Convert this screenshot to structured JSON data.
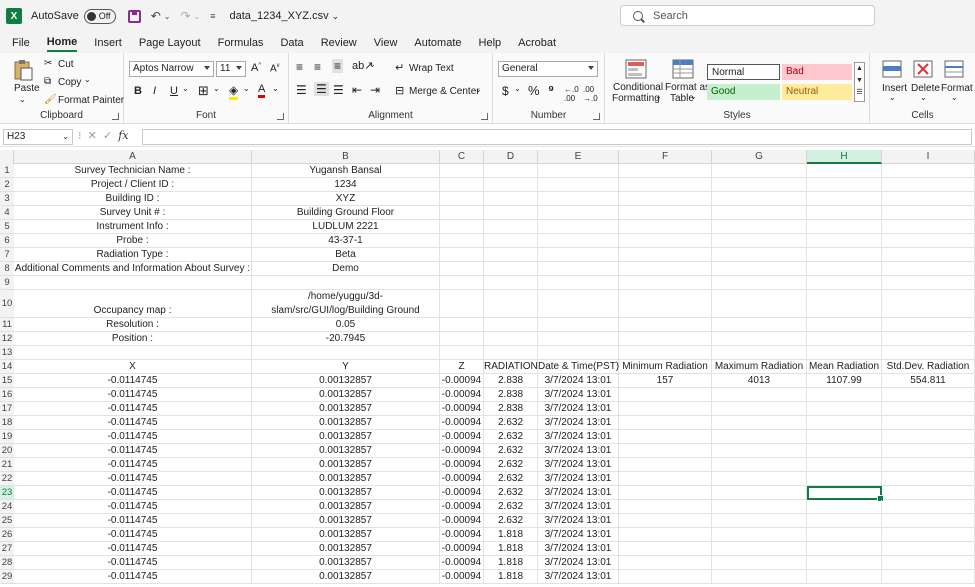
{
  "titlebar": {
    "autosave_label": "AutoSave",
    "autosave_state": "Off",
    "filename": "data_1234_XYZ.csv",
    "search_placeholder": "Search"
  },
  "menu": [
    "File",
    "Home",
    "Insert",
    "Page Layout",
    "Formulas",
    "Data",
    "Review",
    "View",
    "Automate",
    "Help",
    "Acrobat"
  ],
  "menu_active": "Home",
  "ribbon": {
    "clipboard": {
      "paste": "Paste",
      "cut": "Cut",
      "copy": "Copy",
      "format_painter": "Format Painter",
      "label": "Clipboard"
    },
    "font": {
      "name": "Aptos Narrow",
      "size": "11",
      "label": "Font"
    },
    "alignment": {
      "wrap": "Wrap Text",
      "merge": "Merge & Center",
      "label": "Alignment"
    },
    "number": {
      "format": "General",
      "label": "Number"
    },
    "styles": {
      "conditional": "Conditional",
      "formatting": "Formatting",
      "format_as": "Format as",
      "table": "Table",
      "normal": "Normal",
      "bad": "Bad",
      "good": "Good",
      "neutral": "Neutral",
      "label": "Styles"
    },
    "cells": {
      "insert": "Insert",
      "delete": "Delete",
      "format": "Format",
      "label": "Cells"
    }
  },
  "formula_bar": {
    "name_box": "H23",
    "fx": "fx",
    "content": ""
  },
  "selected_cell": "H23",
  "columns": [
    "A",
    "B",
    "C",
    "D",
    "E",
    "F",
    "G",
    "H",
    "I"
  ],
  "rows": [
    {
      "n": "1",
      "A": "Survey Technician Name :",
      "B": "Yugansh Bansal"
    },
    {
      "n": "2",
      "A": "Project / Client ID :",
      "B": "1234"
    },
    {
      "n": "3",
      "A": "Building ID :",
      "B": "XYZ"
    },
    {
      "n": "4",
      "A": "Survey Unit # :",
      "B": "Building Ground Floor"
    },
    {
      "n": "5",
      "A": "Instrument Info :",
      "B": "LUDLUM 2221"
    },
    {
      "n": "6",
      "A": "Probe :",
      "B": "43-37-1"
    },
    {
      "n": "7",
      "A": "Radiation Type :",
      "B": "Beta"
    },
    {
      "n": "8",
      "A": "Additional Comments and Information About Survey :",
      "B": "Demo"
    },
    {
      "n": "9"
    },
    {
      "n": "10",
      "A": "Occupancy map :",
      "B_line1": "/home/yuggu/3d-",
      "B": "slam/src/GUI/log/Building Ground"
    },
    {
      "n": "11",
      "A": "Resolution :",
      "B": "0.05"
    },
    {
      "n": "12",
      "A": "Position :",
      "B": "-20.7945"
    },
    {
      "n": "13"
    },
    {
      "n": "14",
      "A": "X",
      "B": "Y",
      "C": "Z",
      "D": "RADIATION",
      "E": "Date & Time(PST)",
      "F": "Minimum Radiation",
      "G": "Maximum Radiation",
      "H": "Mean Radiation",
      "I": "Std.Dev. Radiation"
    },
    {
      "n": "15",
      "A": "-0.0114745",
      "B": "0.00132857",
      "C": "-0.00094",
      "D": "2.838",
      "E": "3/7/2024 13:01",
      "F": "157",
      "G": "4013",
      "H": "1107.99",
      "I": "554.811"
    },
    {
      "n": "16",
      "A": "-0.0114745",
      "B": "0.00132857",
      "C": "-0.00094",
      "D": "2.838",
      "E": "3/7/2024 13:01"
    },
    {
      "n": "17",
      "A": "-0.0114745",
      "B": "0.00132857",
      "C": "-0.00094",
      "D": "2.838",
      "E": "3/7/2024 13:01"
    },
    {
      "n": "18",
      "A": "-0.0114745",
      "B": "0.00132857",
      "C": "-0.00094",
      "D": "2.632",
      "E": "3/7/2024 13:01"
    },
    {
      "n": "19",
      "A": "-0.0114745",
      "B": "0.00132857",
      "C": "-0.00094",
      "D": "2.632",
      "E": "3/7/2024 13:01"
    },
    {
      "n": "20",
      "A": "-0.0114745",
      "B": "0.00132857",
      "C": "-0.00094",
      "D": "2.632",
      "E": "3/7/2024 13:01"
    },
    {
      "n": "21",
      "A": "-0.0114745",
      "B": "0.00132857",
      "C": "-0.00094",
      "D": "2.632",
      "E": "3/7/2024 13:01"
    },
    {
      "n": "22",
      "A": "-0.0114745",
      "B": "0.00132857",
      "C": "-0.00094",
      "D": "2.632",
      "E": "3/7/2024 13:01"
    },
    {
      "n": "23",
      "A": "-0.0114745",
      "B": "0.00132857",
      "C": "-0.00094",
      "D": "2.632",
      "E": "3/7/2024 13:01"
    },
    {
      "n": "24",
      "A": "-0.0114745",
      "B": "0.00132857",
      "C": "-0.00094",
      "D": "2.632",
      "E": "3/7/2024 13:01"
    },
    {
      "n": "25",
      "A": "-0.0114745",
      "B": "0.00132857",
      "C": "-0.00094",
      "D": "2.632",
      "E": "3/7/2024 13:01"
    },
    {
      "n": "26",
      "A": "-0.0114745",
      "B": "0.00132857",
      "C": "-0.00094",
      "D": "1.818",
      "E": "3/7/2024 13:01"
    },
    {
      "n": "27",
      "A": "-0.0114745",
      "B": "0.00132857",
      "C": "-0.00094",
      "D": "1.818",
      "E": "3/7/2024 13:01"
    },
    {
      "n": "28",
      "A": "-0.0114745",
      "B": "0.00132857",
      "C": "-0.00094",
      "D": "1.818",
      "E": "3/7/2024 13:01"
    },
    {
      "n": "29",
      "A": "-0.0114745",
      "B": "0.00132857",
      "C": "-0.00094",
      "D": "1.818",
      "E": "3/7/2024 13:01"
    }
  ],
  "colors": {
    "excel_green": "#107c41",
    "bad_bg": "#ffc7ce",
    "good_bg": "#c6efce",
    "neutral_bg": "#ffeb9c"
  }
}
